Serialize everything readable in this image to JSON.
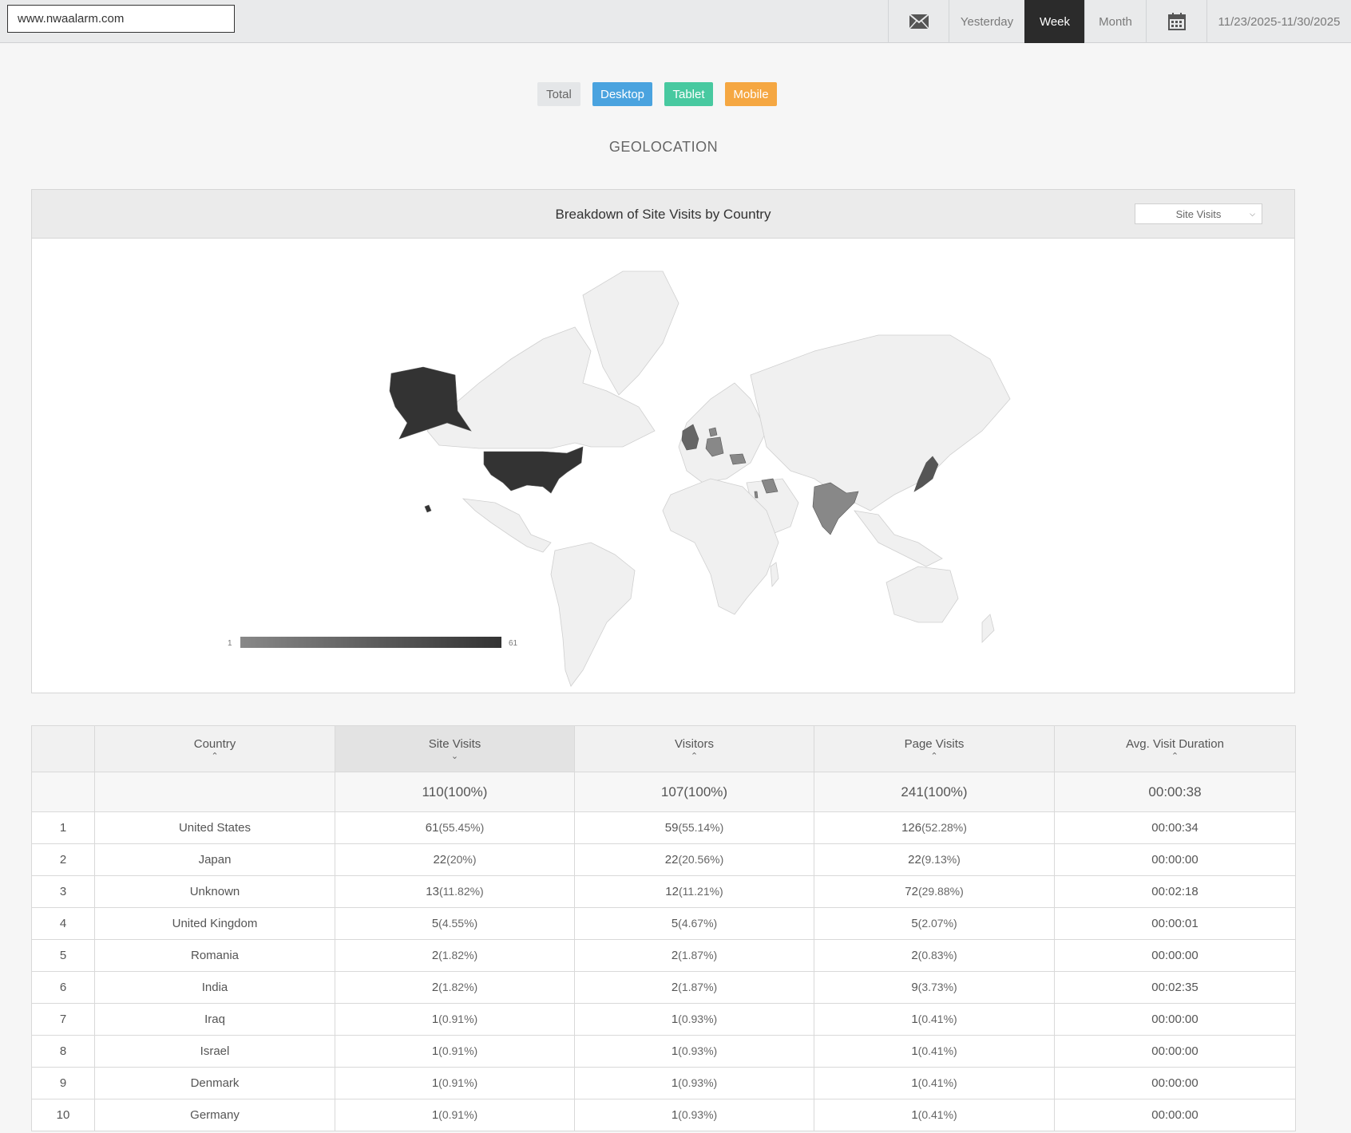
{
  "topbar": {
    "site_value": "www.nwaalarm.com",
    "mail_icon": "mail-icon",
    "yesterday": "Yesterday",
    "week": "Week",
    "month": "Month",
    "calendar_icon": "calendar-icon",
    "date_range": "11/23/2025-11/30/2025"
  },
  "filters": {
    "total": "Total",
    "desktop": "Desktop",
    "tablet": "Tablet",
    "mobile": "Mobile",
    "colors": {
      "desktop": "#4aa3df",
      "tablet": "#48c9a0",
      "mobile": "#f5a742"
    }
  },
  "section_title": "GEOLOCATION",
  "map_panel": {
    "title": "Breakdown of Site Visits by Country",
    "metric_select": "Site Visits",
    "legend_min": "1",
    "legend_max": "61",
    "shaded_countries": [
      {
        "name": "United States",
        "value": 61
      },
      {
        "name": "Japan",
        "value": 22
      },
      {
        "name": "United Kingdom",
        "value": 5
      },
      {
        "name": "Romania",
        "value": 2
      },
      {
        "name": "India",
        "value": 2
      },
      {
        "name": "Iraq",
        "value": 1
      },
      {
        "name": "Israel",
        "value": 1
      },
      {
        "name": "Denmark",
        "value": 1
      },
      {
        "name": "Germany",
        "value": 1
      }
    ]
  },
  "table": {
    "headers": {
      "country": "Country",
      "site_visits": "Site Visits",
      "visitors": "Visitors",
      "page_visits": "Page Visits",
      "duration": "Avg. Visit Duration"
    },
    "totals": {
      "site_visits": "110(100%)",
      "visitors": "107(100%)",
      "page_visits": "241(100%)",
      "duration": "00:00:38"
    },
    "rows": [
      {
        "rank": "1",
        "country": "United States",
        "sv": "61",
        "sv_pct": "(55.45%)",
        "vi": "59",
        "vi_pct": "(55.14%)",
        "pv": "126",
        "pv_pct": "(52.28%)",
        "dur": "00:00:34"
      },
      {
        "rank": "2",
        "country": "Japan",
        "sv": "22",
        "sv_pct": "(20%)",
        "vi": "22",
        "vi_pct": "(20.56%)",
        "pv": "22",
        "pv_pct": "(9.13%)",
        "dur": "00:00:00"
      },
      {
        "rank": "3",
        "country": "Unknown",
        "sv": "13",
        "sv_pct": "(11.82%)",
        "vi": "12",
        "vi_pct": "(11.21%)",
        "pv": "72",
        "pv_pct": "(29.88%)",
        "dur": "00:02:18"
      },
      {
        "rank": "4",
        "country": "United Kingdom",
        "sv": "5",
        "sv_pct": "(4.55%)",
        "vi": "5",
        "vi_pct": "(4.67%)",
        "pv": "5",
        "pv_pct": "(2.07%)",
        "dur": "00:00:01"
      },
      {
        "rank": "5",
        "country": "Romania",
        "sv": "2",
        "sv_pct": "(1.82%)",
        "vi": "2",
        "vi_pct": "(1.87%)",
        "pv": "2",
        "pv_pct": "(0.83%)",
        "dur": "00:00:00"
      },
      {
        "rank": "6",
        "country": "India",
        "sv": "2",
        "sv_pct": "(1.82%)",
        "vi": "2",
        "vi_pct": "(1.87%)",
        "pv": "9",
        "pv_pct": "(3.73%)",
        "dur": "00:02:35"
      },
      {
        "rank": "7",
        "country": "Iraq",
        "sv": "1",
        "sv_pct": "(0.91%)",
        "vi": "1",
        "vi_pct": "(0.93%)",
        "pv": "1",
        "pv_pct": "(0.41%)",
        "dur": "00:00:00"
      },
      {
        "rank": "8",
        "country": "Israel",
        "sv": "1",
        "sv_pct": "(0.91%)",
        "vi": "1",
        "vi_pct": "(0.93%)",
        "pv": "1",
        "pv_pct": "(0.41%)",
        "dur": "00:00:00"
      },
      {
        "rank": "9",
        "country": "Denmark",
        "sv": "1",
        "sv_pct": "(0.91%)",
        "vi": "1",
        "vi_pct": "(0.93%)",
        "pv": "1",
        "pv_pct": "(0.41%)",
        "dur": "00:00:00"
      },
      {
        "rank": "10",
        "country": "Germany",
        "sv": "1",
        "sv_pct": "(0.91%)",
        "vi": "1",
        "vi_pct": "(0.93%)",
        "pv": "1",
        "pv_pct": "(0.41%)",
        "dur": "00:00:00"
      }
    ]
  }
}
